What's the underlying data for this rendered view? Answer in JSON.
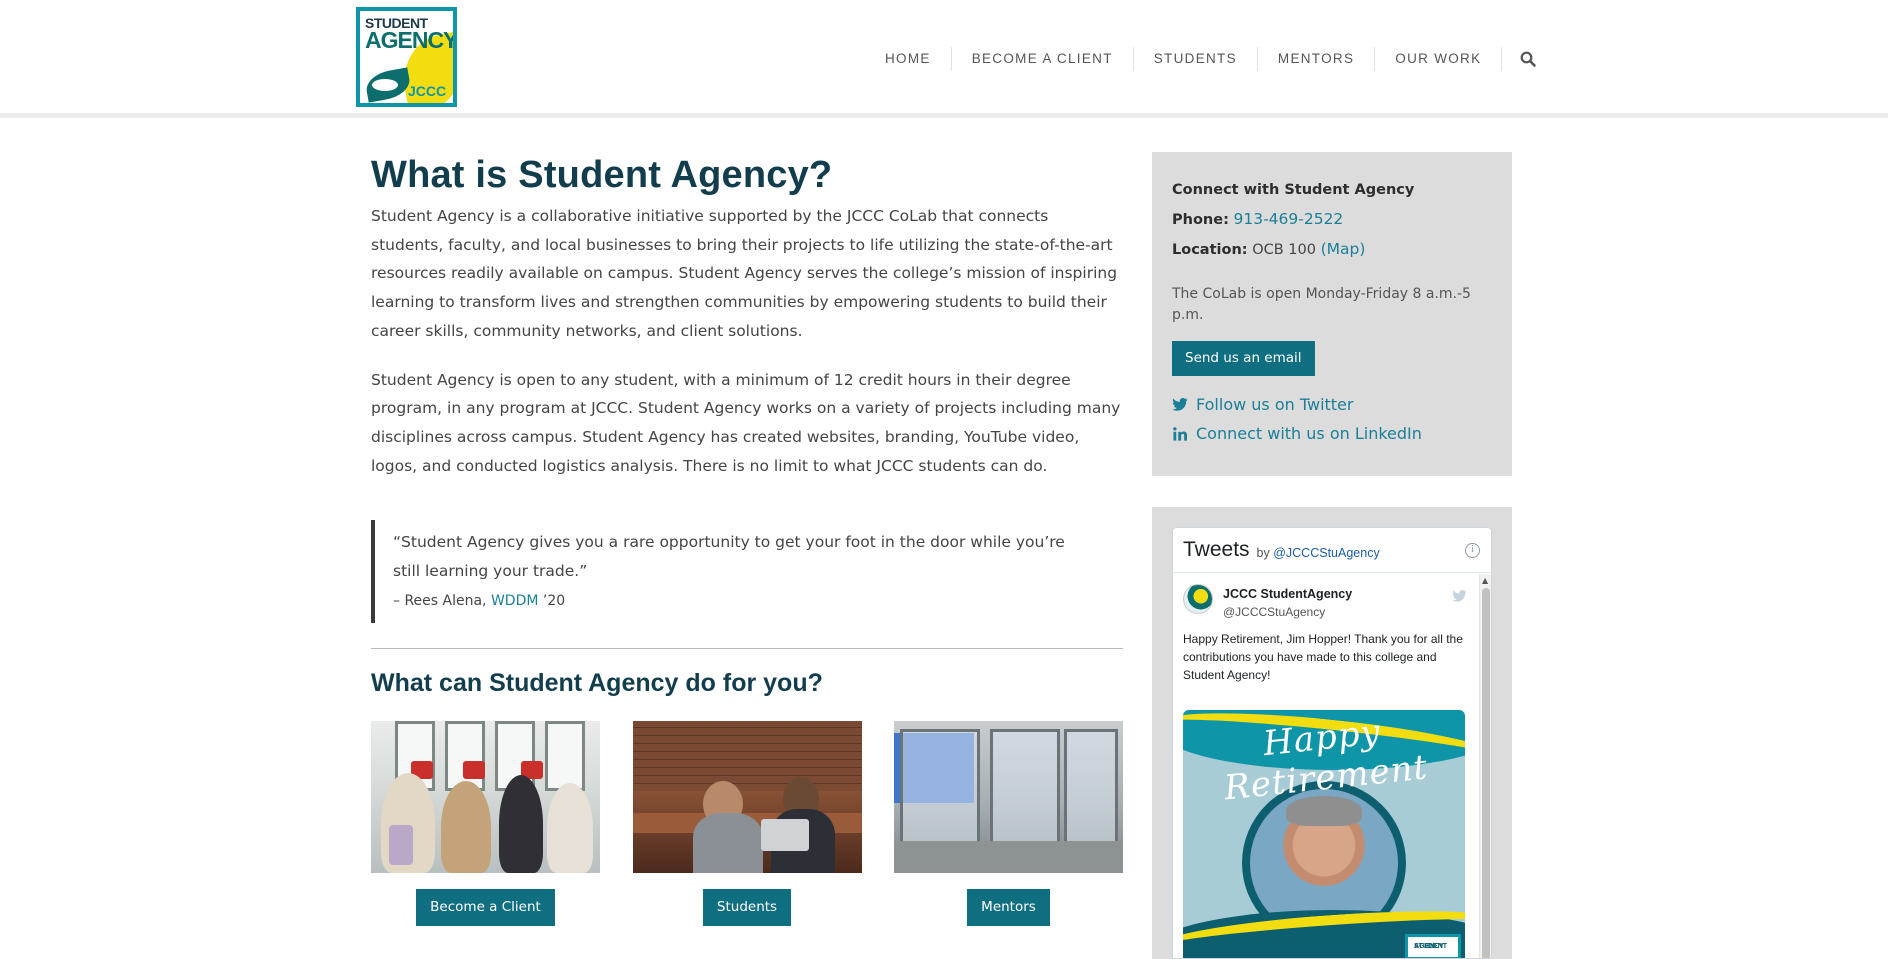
{
  "header": {
    "logo": {
      "line1": "STUDENT",
      "line2": "AGENCY",
      "line3": "JCCC"
    },
    "nav": [
      {
        "label": "HOME"
      },
      {
        "label": "BECOME A CLIENT"
      },
      {
        "label": "STUDENTS"
      },
      {
        "label": "MENTORS"
      },
      {
        "label": "OUR WORK"
      }
    ],
    "search_icon": "search-icon"
  },
  "main": {
    "title": "What is Student Agency?",
    "para1": "Student Agency is a collaborative initiative supported by the JCCC CoLab that connects students, faculty, and local businesses to bring their projects to life utilizing the state-of-the-art resources readily available on campus. Student Agency serves the college’s mission of inspiring learning to transform lives and strengthen communities by empowering students to build their career skills, community networks, and client solutions.",
    "para2": "Student Agency is open to any student, with a minimum of 12 credit hours in their degree program, in any program at JCCC. Student Agency works on a variety of projects including many disciplines across campus. Student Agency has created websites, branding, YouTube video, logos, and conducted logistics analysis. There is no limit to what JCCC students can do.",
    "quote": {
      "text": "“Student Agency gives you a rare opportunity to get your foot in the door while you’re still learning your trade.”",
      "cite_prefix": "– Rees Alena, ",
      "cite_link": "WDDM",
      "cite_suffix": " ’20"
    },
    "section_title": "What can Student Agency do for you?",
    "cards": [
      {
        "button": "Become a Client"
      },
      {
        "button": "Students"
      },
      {
        "button": "Mentors"
      }
    ]
  },
  "sidebar": {
    "connect": {
      "title": "Connect with Student Agency",
      "phone_label": "Phone:",
      "phone": "913-469-2522",
      "location_label": "Location:",
      "location": "OCB 100",
      "map_link": "(Map)",
      "hours": "The CoLab is open Monday-Friday 8 a.m.-5 p.m.",
      "email_button": "Send us an email",
      "twitter": "Follow us on Twitter",
      "linkedin": "Connect with us on LinkedIn"
    },
    "tweets": {
      "title": "Tweets",
      "by": "by",
      "handle_link": "@JCCCStuAgency",
      "info": "i",
      "tweet": {
        "name": "JCCC StudentAgency",
        "handle": "@JCCCStuAgency",
        "text": "Happy Retirement, Jim Hopper! Thank you for all the contributions you have made to this college and Student Agency!",
        "image_text": "Happy Retirement",
        "badge_line1": "STUDENT",
        "badge_line2": "AGENCY"
      }
    }
  },
  "colors": {
    "accent": "#0f6e80",
    "link": "#1b7f98",
    "heading": "#123d4d",
    "panel": "#dcdcdc"
  }
}
